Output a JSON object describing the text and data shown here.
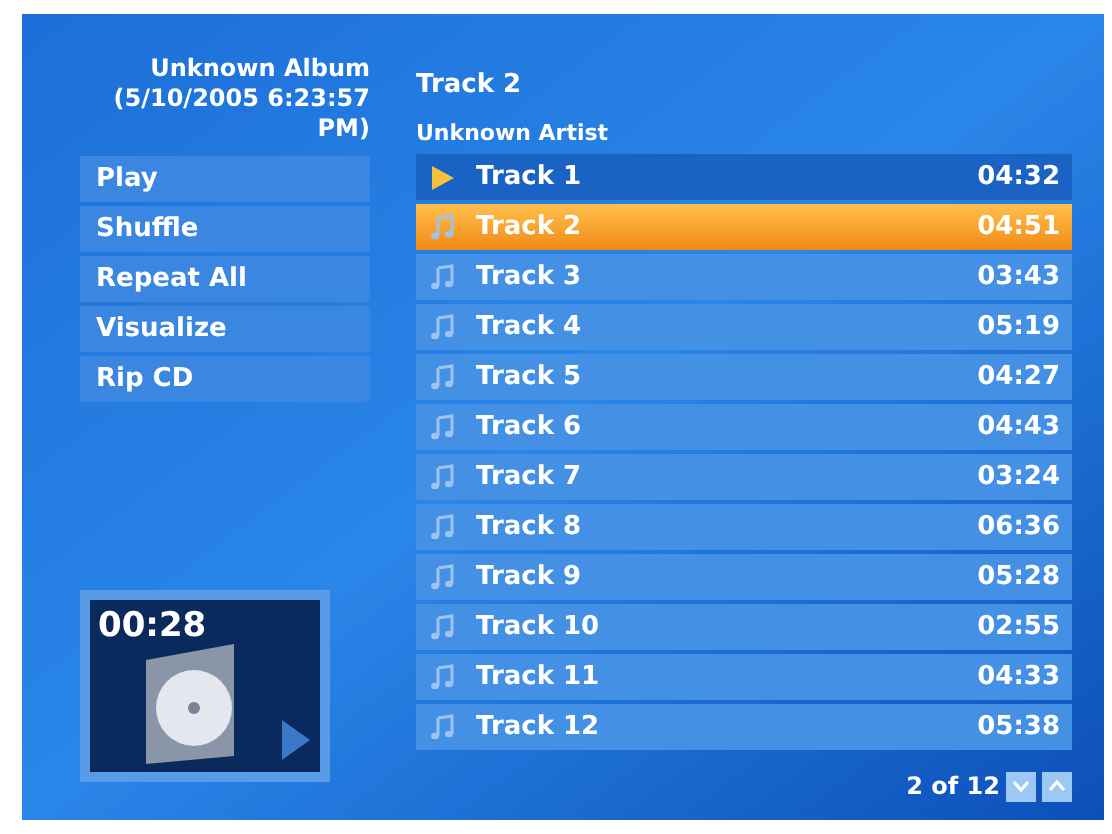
{
  "album": {
    "title": "Unknown Album (5/10/2005 6:23:57 PM)"
  },
  "menu": [
    {
      "label": "Play"
    },
    {
      "label": "Shuffle"
    },
    {
      "label": "Repeat All"
    },
    {
      "label": "Visualize"
    },
    {
      "label": "Rip CD"
    }
  ],
  "now_playing": {
    "time": "00:28"
  },
  "header": {
    "track": "Track 2",
    "artist": "Unknown Artist"
  },
  "tracks": [
    {
      "title": "Track 1",
      "duration": "04:32",
      "selected": false,
      "playing": true
    },
    {
      "title": "Track 2",
      "duration": "04:51",
      "selected": true,
      "playing": false
    },
    {
      "title": "Track 3",
      "duration": "03:43",
      "selected": false,
      "playing": false
    },
    {
      "title": "Track 4",
      "duration": "05:19",
      "selected": false,
      "playing": false
    },
    {
      "title": "Track 5",
      "duration": "04:27",
      "selected": false,
      "playing": false
    },
    {
      "title": "Track 6",
      "duration": "04:43",
      "selected": false,
      "playing": false
    },
    {
      "title": "Track 7",
      "duration": "03:24",
      "selected": false,
      "playing": false
    },
    {
      "title": "Track 8",
      "duration": "06:36",
      "selected": false,
      "playing": false
    },
    {
      "title": "Track 9",
      "duration": "05:28",
      "selected": false,
      "playing": false
    },
    {
      "title": "Track 10",
      "duration": "02:55",
      "selected": false,
      "playing": false
    },
    {
      "title": "Track 11",
      "duration": "04:33",
      "selected": false,
      "playing": false
    },
    {
      "title": "Track 12",
      "duration": "05:38",
      "selected": false,
      "playing": false
    }
  ],
  "pager": {
    "text": "2 of 12"
  }
}
